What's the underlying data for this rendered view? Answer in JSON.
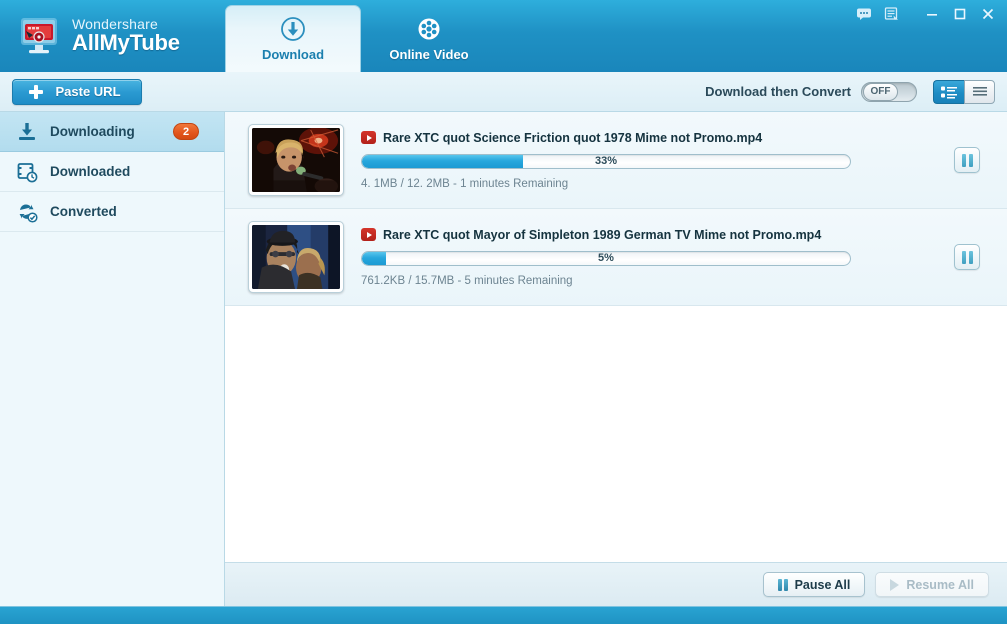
{
  "app": {
    "brand_sub": "Wondershare",
    "brand_main": "AllMyTube",
    "logo_icon": "monitor-video-icon"
  },
  "titlebar": {
    "feedback_icon": "chat-bubble-icon",
    "register_icon": "register-list-icon",
    "minimize_label": "minimize-icon",
    "maximize_label": "maximize-icon",
    "close_label": "close-icon"
  },
  "tabs": [
    {
      "label": "Download",
      "icon": "download-circle-icon",
      "active": true
    },
    {
      "label": "Online Video",
      "icon": "film-reel-icon",
      "active": false
    }
  ],
  "toolbar": {
    "paste_url_label": "Paste URL",
    "paste_icon": "plus-icon",
    "download_then_convert_label": "Download then Convert",
    "toggle_state": "OFF",
    "view_detail_icon": "detail-view-icon",
    "view_list_icon": "list-view-icon",
    "view_active": "detail"
  },
  "sidebar": {
    "items": [
      {
        "label": "Downloading",
        "icon": "download-arrow-icon",
        "badge": "2",
        "active": true
      },
      {
        "label": "Downloaded",
        "icon": "film-clock-icon",
        "badge": "",
        "active": false
      },
      {
        "label": "Converted",
        "icon": "convert-check-icon",
        "badge": "",
        "active": false
      }
    ]
  },
  "downloads": [
    {
      "title": "Rare XTC  quot Science Friction quot  1978 Mime  not Promo.mp4",
      "source_icon": "youtube-play-icon",
      "percent_label": "33%",
      "percent": 33,
      "meta": "4. 1MB / 12. 2MB - 1 minutes Remaining",
      "pause_icon": "pause-icon",
      "thumb_alt": "concert-singer-thumbnail"
    },
    {
      "title": "Rare XTC  quot Mayor of Simpleton 1989 German TV Mime not Promo.mp4",
      "source_icon": "youtube-play-icon",
      "percent_label": "5%",
      "percent": 5,
      "meta": "761.2KB / 15.7MB - 5 minutes Remaining",
      "pause_icon": "pause-icon",
      "thumb_alt": "hat-singer-thumbnail"
    }
  ],
  "actionbar": {
    "pause_all_label": "Pause All",
    "pause_all_icon": "pause-icon",
    "resume_all_label": "Resume All",
    "resume_all_icon": "play-icon",
    "resume_all_disabled": true
  },
  "colors": {
    "header_blue": "#1f91c4",
    "accent_blue": "#27a7dd",
    "badge_orange": "#e2551c",
    "sidebar_bg": "#eef8fc",
    "tab_active_bg": "#e9f6fb"
  }
}
